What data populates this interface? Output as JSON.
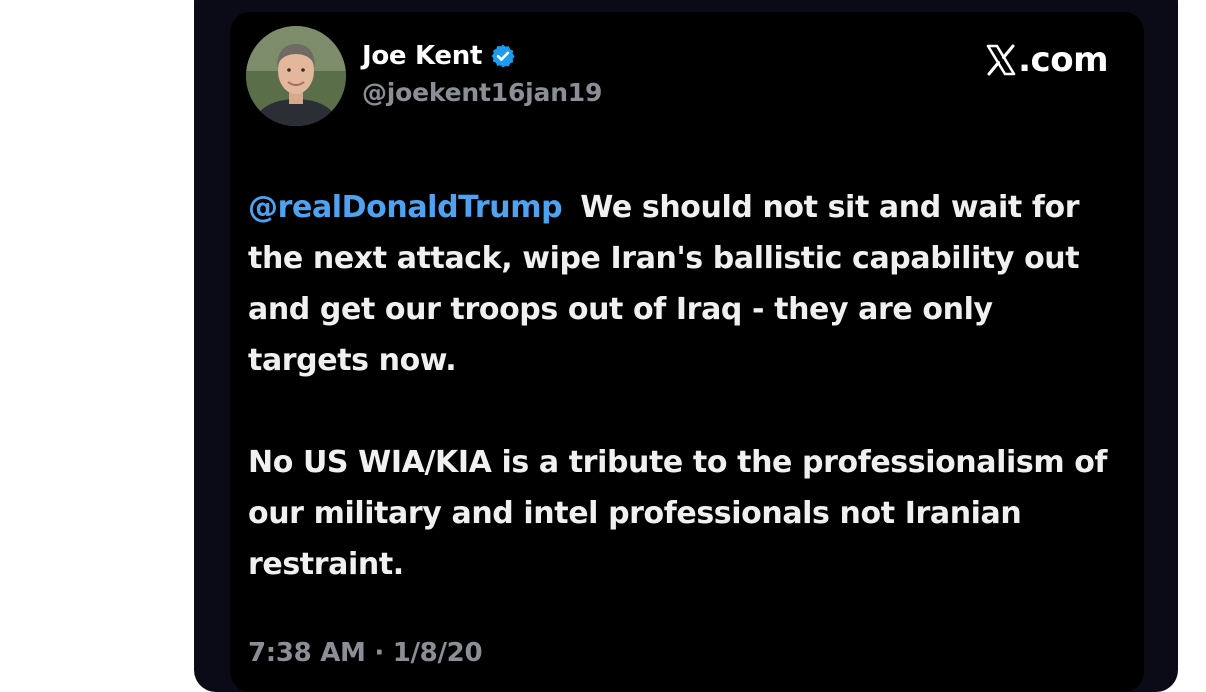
{
  "tweet": {
    "display_name": "Joe Kent",
    "handle": "@joekent16jan19",
    "source": ".com",
    "source_icon": "x-logo-icon",
    "verified_icon": "verified-badge-icon",
    "mention": "@realDonaldTrump",
    "paragraph1_rest": "We should not sit and wait for the next attack, wipe Iran's ballistic capability out and get our troops out of Iraq - they are only targets now.",
    "paragraph2": "No US WIA/KIA is a tribute to the professionalism of our military and intel professionals not Iranian restraint.",
    "timestamp": "7:38 AM · 1/8/20"
  },
  "colors": {
    "card_background": "#000000",
    "frame_background": "#0b0b17",
    "mention_blue": "#4ea2f0",
    "verified_blue": "#1d9bf0",
    "muted_gray": "#8b8f95"
  }
}
